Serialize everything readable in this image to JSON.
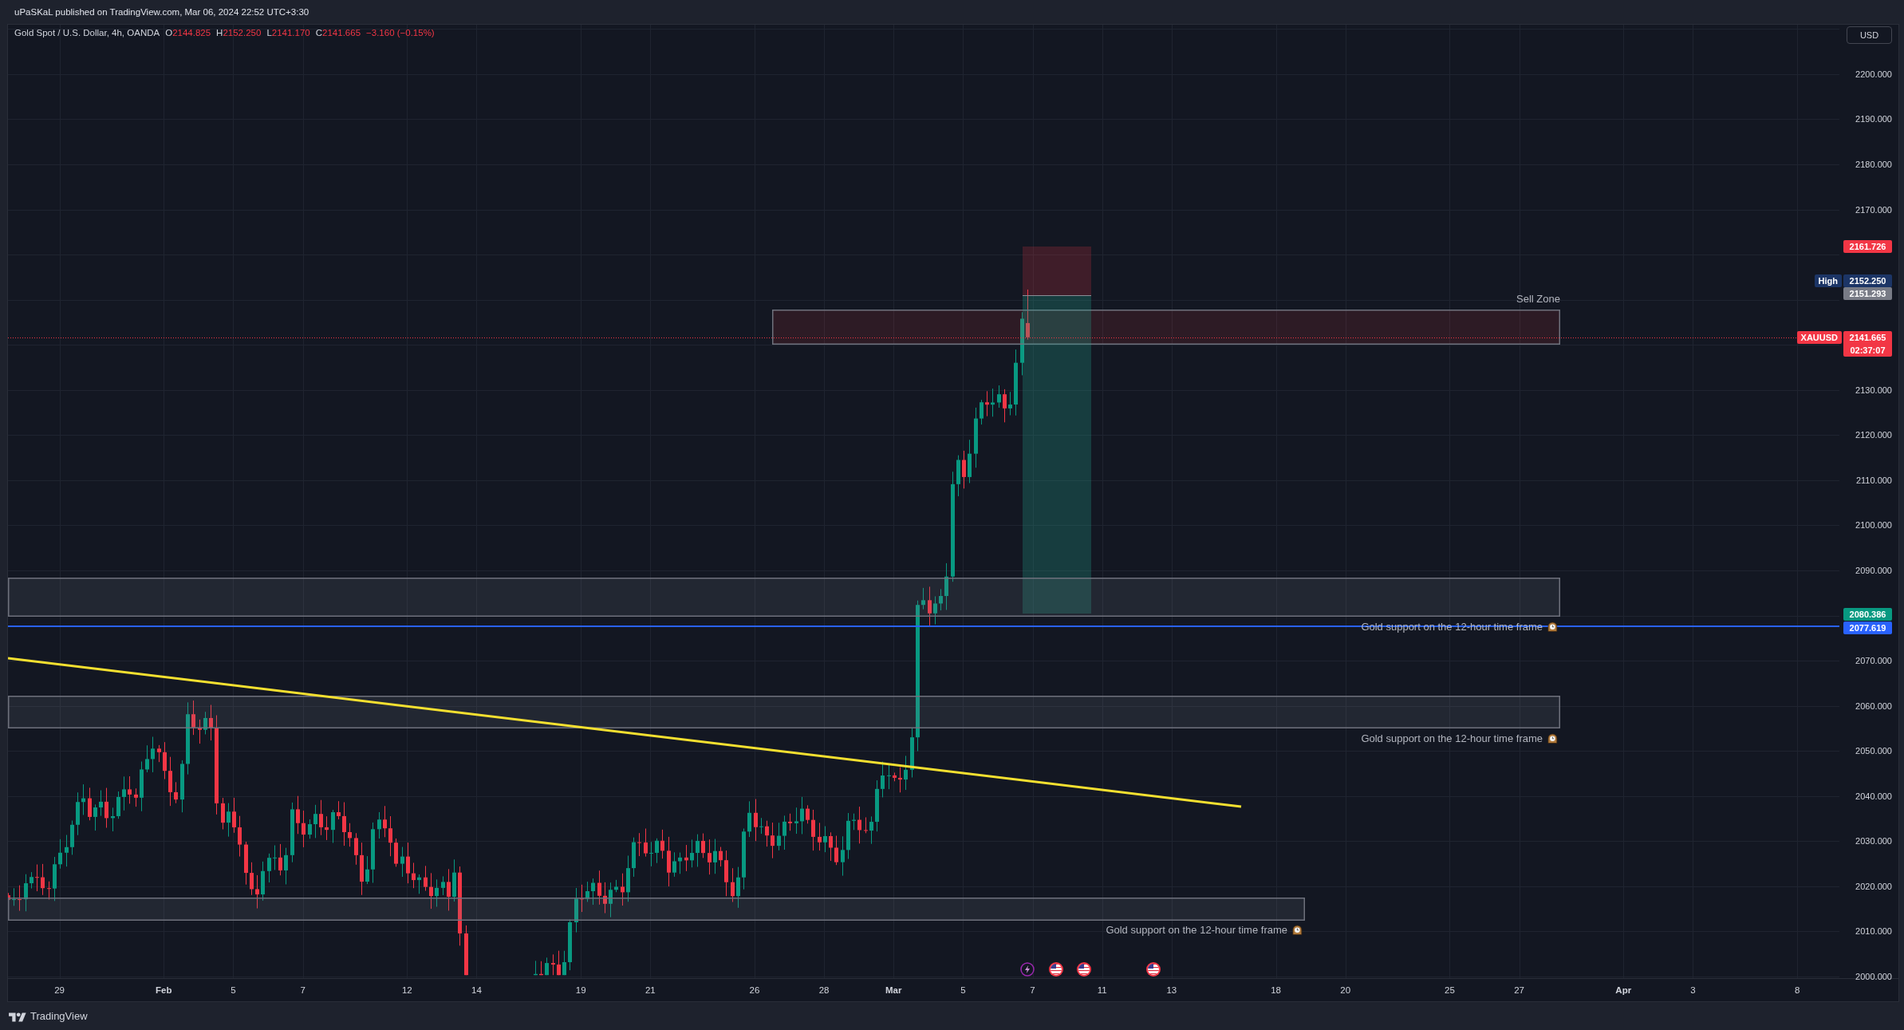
{
  "header": {
    "text": "uPaSKaL published on TradingView.com, Mar 06, 2024 22:52 UTC+3:30"
  },
  "legend": {
    "title": "Gold Spot / U.S. Dollar, 4h, OANDA",
    "values": [
      {
        "key": "O",
        "value": "2144.825"
      },
      {
        "key": "H",
        "value": "2152.250"
      },
      {
        "key": "L",
        "value": "2141.170"
      },
      {
        "key": "C",
        "value": "2141.665"
      }
    ],
    "change": "−3.160 (−0.15%)"
  },
  "currency": "USD",
  "price_axis": {
    "labels": [
      "2200.000",
      "2190.000",
      "2180.000",
      "2170.000",
      "2130.000",
      "2120.000",
      "2110.000",
      "2100.000",
      "2090.000",
      "2070.000",
      "2060.000",
      "2050.000",
      "2040.000",
      "2030.000",
      "2020.000",
      "2010.000",
      "2000.000"
    ]
  },
  "price_tags": [
    {
      "value": "2161.726",
      "color": "#f23645"
    },
    {
      "caption": "High",
      "value": "2152.250",
      "color": "#1c3566"
    },
    {
      "value": "2151.293",
      "color": "#787b86"
    },
    {
      "caption": "XAUUSD",
      "value": "2141.665",
      "countdown": "02:37:07",
      "color": "#f23645"
    },
    {
      "value": "2080.386",
      "color": "#089981"
    },
    {
      "value": "2077.619",
      "color": "#2962ff"
    }
  ],
  "drawings": [
    {
      "kind": "sell_zone",
      "label": "Sell Zone"
    },
    {
      "kind": "short_position"
    },
    {
      "kind": "support_zone",
      "label": "Gold support on the 12-hour time frame"
    },
    {
      "kind": "horizontal_line"
    },
    {
      "kind": "support_zone",
      "label": "Gold support on the 12-hour time frame"
    },
    {
      "kind": "trend_line"
    },
    {
      "kind": "support_zone",
      "label": "Gold support on the 12-hour time frame"
    }
  ],
  "events": [
    {
      "kind": "flash"
    },
    {
      "kind": "flag"
    },
    {
      "kind": "flag"
    },
    {
      "kind": "flag"
    }
  ],
  "time_axis": {
    "labels": [
      {
        "text": "29",
        "kind": "day"
      },
      {
        "text": "Feb",
        "kind": "month"
      },
      {
        "text": "5",
        "kind": "day"
      },
      {
        "text": "7",
        "kind": "day"
      },
      {
        "text": "12",
        "kind": "day"
      },
      {
        "text": "14",
        "kind": "day"
      },
      {
        "text": "19",
        "kind": "day"
      },
      {
        "text": "21",
        "kind": "day"
      },
      {
        "text": "26",
        "kind": "day"
      },
      {
        "text": "28",
        "kind": "day"
      },
      {
        "text": "Mar",
        "kind": "month"
      },
      {
        "text": "5",
        "kind": "day"
      },
      {
        "text": "7",
        "kind": "day"
      },
      {
        "text": "11",
        "kind": "day"
      },
      {
        "text": "13",
        "kind": "day"
      },
      {
        "text": "18",
        "kind": "day"
      },
      {
        "text": "20",
        "kind": "day"
      },
      {
        "text": "25",
        "kind": "day"
      },
      {
        "text": "27",
        "kind": "day"
      },
      {
        "text": "Apr",
        "kind": "month"
      },
      {
        "text": "3",
        "kind": "day"
      },
      {
        "text": "8",
        "kind": "day"
      }
    ]
  },
  "footer": {
    "brand": "TradingView"
  }
}
